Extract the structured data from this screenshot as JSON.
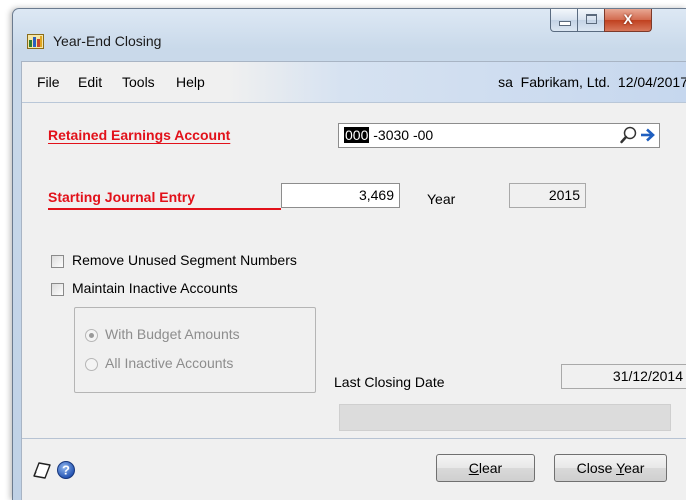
{
  "window": {
    "title": "Year-End Closing",
    "controls": {
      "minimize": "minimize",
      "maximize": "maximize",
      "close": "X"
    }
  },
  "menu": {
    "items": [
      "File",
      "Edit",
      "Tools",
      "Help"
    ],
    "user": "sa",
    "company": "Fabrikam, Ltd.",
    "date": "12/04/2017"
  },
  "form": {
    "retained_label": "Retained Earnings Account",
    "account": {
      "segment1": "000",
      "rest": " -3030 -00"
    },
    "starting_label": "Starting Journal Entry",
    "starting_value": "3,469",
    "year_label": "Year",
    "year_value": "2015",
    "remove_unused_label": "Remove Unused Segment Numbers",
    "remove_unused_checked": false,
    "maintain_inactive_label": "Maintain Inactive Accounts",
    "maintain_inactive_checked": false,
    "options": [
      {
        "label": "With Budget Amounts",
        "selected": true,
        "enabled": false
      },
      {
        "label": "All Inactive Accounts",
        "selected": false,
        "enabled": false
      }
    ],
    "last_closing_label": "Last Closing Date",
    "last_closing_value": "31/12/2014"
  },
  "footer": {
    "clear_button": {
      "before": "",
      "underlined": "C",
      "after": "lear"
    },
    "close_year_button": {
      "before": "Close ",
      "underlined": "Y",
      "after": "ear"
    }
  },
  "icons": [
    "application-icon",
    "lookup-icon",
    "expansion-arrow-icon",
    "note-icon",
    "help-icon"
  ],
  "colors": {
    "required_label": "#e2111a",
    "title_gradient": "#c9d9ea",
    "close_button": "#c0401f"
  }
}
